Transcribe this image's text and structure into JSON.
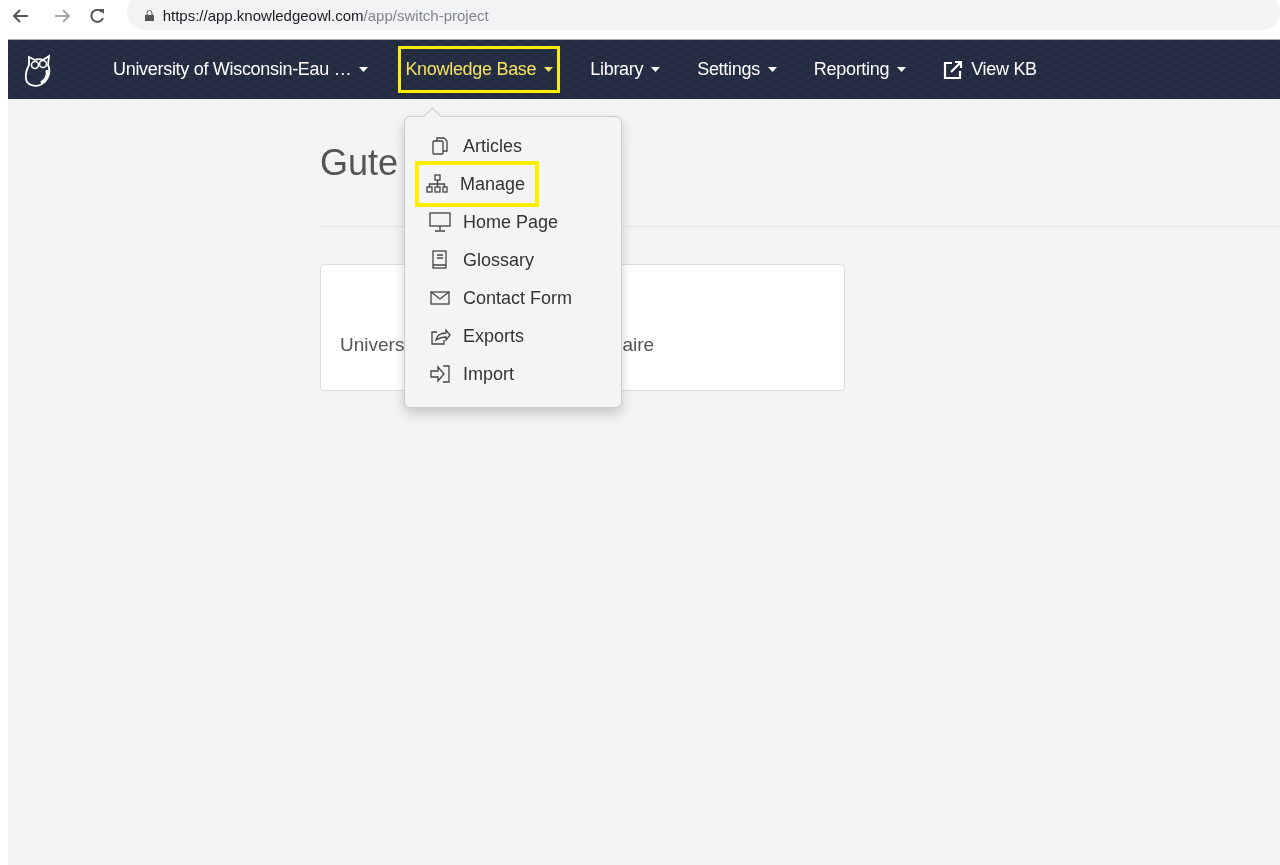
{
  "browser": {
    "url_host": "https://app.knowledgeowl.com",
    "url_path": "/app/switch-project"
  },
  "navbar": {
    "items": [
      {
        "label": "University of Wisconsin-Eau …",
        "kind": "dropdown",
        "highlighted": false
      },
      {
        "label": "Knowledge Base",
        "kind": "dropdown",
        "highlighted": true
      },
      {
        "label": "Library",
        "kind": "dropdown",
        "highlighted": false
      },
      {
        "label": "Settings",
        "kind": "dropdown",
        "highlighted": false
      },
      {
        "label": "Reporting",
        "kind": "dropdown",
        "highlighted": false
      },
      {
        "label": "View KB",
        "kind": "external",
        "highlighted": false
      }
    ]
  },
  "page": {
    "heading": "Gute",
    "card_text_start": "Univers",
    "card_text_end": "aire"
  },
  "dropdown_menu": {
    "items": [
      {
        "label": "Articles",
        "highlighted": false
      },
      {
        "label": "Manage",
        "highlighted": true
      },
      {
        "label": "Home Page",
        "highlighted": false
      },
      {
        "label": "Glossary",
        "highlighted": false
      },
      {
        "label": "Contact Form",
        "highlighted": false
      },
      {
        "label": "Exports",
        "highlighted": false
      },
      {
        "label": "Import",
        "highlighted": false
      }
    ]
  }
}
